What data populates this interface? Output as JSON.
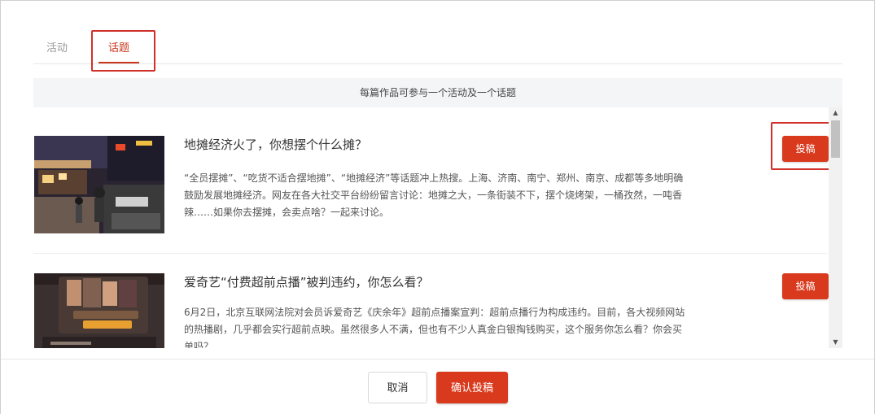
{
  "tabs": [
    {
      "label": "活动",
      "active": false
    },
    {
      "label": "话题",
      "active": true
    }
  ],
  "notice": "每篇作品可参与一个活动及一个话题",
  "topics": [
    {
      "title": "地摊经济火了，你想摆个什么摊？",
      "description": "“全员摆摊”、“吃货不适合摆地摊”、“地摊经济”等话题冲上热搜。上海、济南、南宁、郑州、南京、成都等多地明确鼓励发展地摊经济。网友在各大社交平台纷纷留言讨论：地摊之大，一条街装不下，摆个烧烤架，一桶孜然，一吨香辣……如果你去摆摊，会卖点啥？一起来讨论。",
      "button_label": "投稿",
      "thumbnail_icon": "night-market-photo"
    },
    {
      "title": "爱奇艺“付费超前点播”被判违约，你怎么看？",
      "description": "6月2日，北京互联网法院对会员诉爱奇艺《庆余年》超前点播案宣判：超前点播行为构成违约。目前，各大视频网站的热播剧，几乎都会实行超前点映。虽然很多人不满，但也有不少人真金白银掏钱购买，这个服务你怎么看？你会买单吗？",
      "button_label": "投稿",
      "thumbnail_icon": "phone-app-screenshot"
    }
  ],
  "footer": {
    "cancel_label": "取消",
    "confirm_label": "确认投稿"
  },
  "colors": {
    "accent": "#d93a1e",
    "highlight_box": "#d0302a"
  }
}
